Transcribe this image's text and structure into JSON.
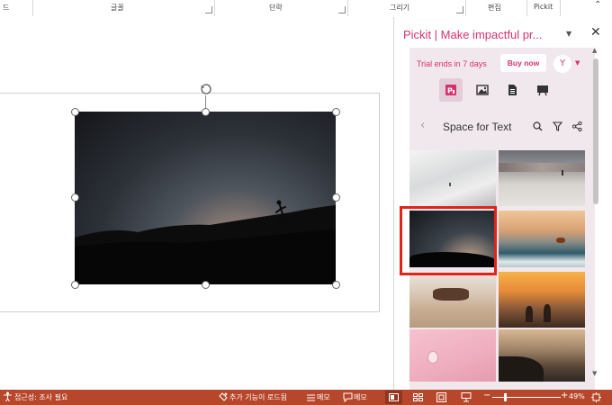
{
  "ribbon": {
    "group_0": "드",
    "font": "글꼴",
    "paragraph": "단락",
    "drawing": "그리기",
    "editing": "편집",
    "pickit": "Pickit"
  },
  "pane": {
    "title": "Pickit | Make impactful pr...",
    "trial": "Trial ends in 7 days",
    "buy": "Buy now",
    "avatar": "Y",
    "tabs": [
      "pickit-icon",
      "image-icon",
      "document-icon",
      "presentation-icon"
    ],
    "collection_title": "Space for Text",
    "thumbnails": [
      {
        "name": "thumb-white-waves",
        "selected": false
      },
      {
        "name": "thumb-desert-runner",
        "selected": false
      },
      {
        "name": "thumb-hill-silhouette",
        "selected": true
      },
      {
        "name": "thumb-ocean-surfer",
        "selected": false
      },
      {
        "name": "thumb-horses",
        "selected": false
      },
      {
        "name": "thumb-sunset-people",
        "selected": false
      },
      {
        "name": "thumb-pink-bulb",
        "selected": false
      },
      {
        "name": "thumb-cliff-sunset",
        "selected": false
      }
    ]
  },
  "status": {
    "accessibility": "접근성: 조사 필요",
    "addins": "추가 기능이 로드됨",
    "notes": "메모",
    "comments": "메모",
    "zoom": "49%"
  },
  "colors": {
    "accent": "#d6316e",
    "status_bar": "#b7472a",
    "selection": "#e2231a",
    "pane_bg": "#f1e8ee"
  }
}
